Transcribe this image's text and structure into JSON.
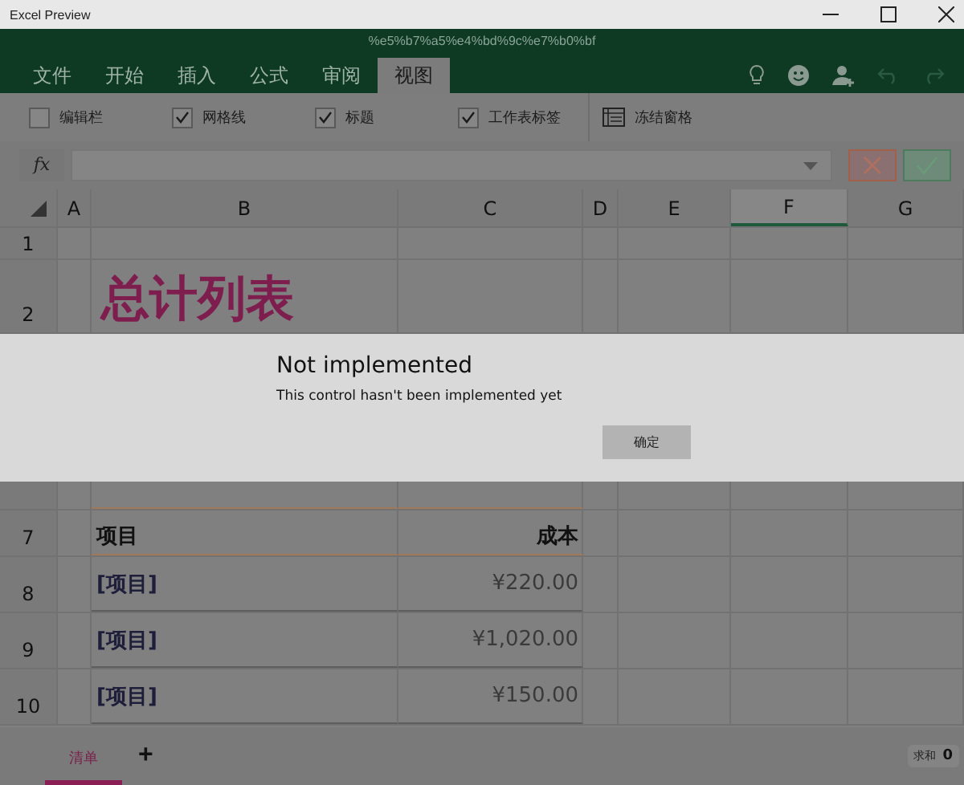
{
  "window": {
    "title": "Excel Preview"
  },
  "document_title": "%e5%b7%a5%e4%bd%9c%e7%b0%bf",
  "ribbon": {
    "tabs": [
      {
        "label": "文件",
        "selected": false
      },
      {
        "label": "开始",
        "selected": false
      },
      {
        "label": "插入",
        "selected": false
      },
      {
        "label": "公式",
        "selected": false
      },
      {
        "label": "审阅",
        "selected": false
      },
      {
        "label": "视图",
        "selected": true
      }
    ],
    "options": [
      {
        "label": "编辑栏",
        "checked": false
      },
      {
        "label": "网格线",
        "checked": true
      },
      {
        "label": "标题",
        "checked": true
      },
      {
        "label": "工作表标签",
        "checked": true
      }
    ],
    "freeze_label": "冻结窗格"
  },
  "formula_bar": {
    "function_label": "fx"
  },
  "grid": {
    "columns": [
      {
        "label": "A",
        "selected": false
      },
      {
        "label": "B",
        "selected": false
      },
      {
        "label": "C",
        "selected": false
      },
      {
        "label": "D",
        "selected": false
      },
      {
        "label": "E",
        "selected": false
      },
      {
        "label": "F",
        "selected": true
      },
      {
        "label": "G",
        "selected": false
      }
    ],
    "rows": [
      {
        "kind": "blank",
        "label": "1"
      },
      {
        "kind": "title",
        "label": "2",
        "b": "总计列表"
      },
      {
        "kind": "partial"
      },
      {
        "kind": "header",
        "label": "7",
        "b": "项目",
        "c": "成本"
      },
      {
        "kind": "item",
        "label": "8",
        "b": "[项目]",
        "c": "¥220.00"
      },
      {
        "kind": "item",
        "label": "9",
        "b": "[项目]",
        "c": "¥1,020.00"
      },
      {
        "kind": "item",
        "label": "10",
        "b": "[项目]",
        "c": "¥150.00"
      }
    ]
  },
  "dialog": {
    "title": "Not implemented",
    "message": "This control hasn't been implemented yet",
    "button": "确定"
  },
  "sheet_tabs": [
    {
      "label": "清单",
      "selected": true
    }
  ],
  "add_sheet": "+",
  "status": {
    "sum_label": "求和",
    "sum_value": "0"
  }
}
